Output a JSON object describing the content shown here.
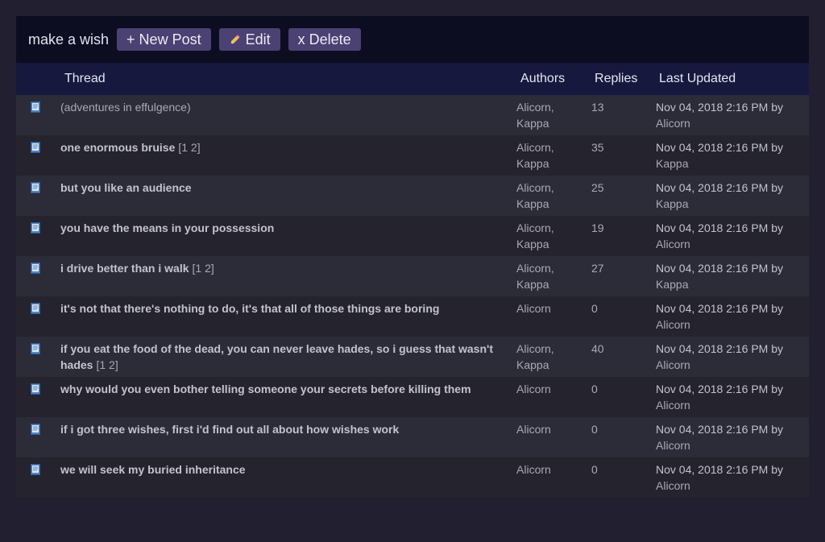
{
  "board": {
    "title": "make a wish",
    "buttons": {
      "new_post": "+ New Post",
      "edit": "Edit",
      "delete": "x Delete"
    }
  },
  "table": {
    "headers": {
      "thread": "Thread",
      "authors": "Authors",
      "replies": "Replies",
      "last_updated": "Last Updated"
    },
    "rows": [
      {
        "title": "(adventures in effulgence)",
        "bold": false,
        "pages": "",
        "authors_line1": "Alicorn,",
        "authors_line2": "Kappa",
        "replies": "13",
        "updated": "Nov 04, 2018 2:16 PM by",
        "updated_by": "Alicorn"
      },
      {
        "title": "one enormous bruise",
        "bold": true,
        "pages": "[1 2]",
        "authors_line1": "Alicorn,",
        "authors_line2": "Kappa",
        "replies": "35",
        "updated": "Nov 04, 2018 2:16 PM by",
        "updated_by": "Kappa"
      },
      {
        "title": "but you like an audience",
        "bold": true,
        "pages": "",
        "authors_line1": "Alicorn,",
        "authors_line2": "Kappa",
        "replies": "25",
        "updated": "Nov 04, 2018 2:16 PM by",
        "updated_by": "Kappa"
      },
      {
        "title": "you have the means in your possession",
        "bold": true,
        "pages": "",
        "authors_line1": "Alicorn,",
        "authors_line2": "Kappa",
        "replies": "19",
        "updated": "Nov 04, 2018 2:16 PM by",
        "updated_by": "Alicorn"
      },
      {
        "title": "i drive better than i walk",
        "bold": true,
        "pages": "[1 2]",
        "authors_line1": "Alicorn,",
        "authors_line2": "Kappa",
        "replies": "27",
        "updated": "Nov 04, 2018 2:16 PM by",
        "updated_by": "Kappa"
      },
      {
        "title": "it's not that there's nothing to do, it's that all of those things are boring",
        "bold": true,
        "pages": "",
        "authors_line1": "Alicorn",
        "authors_line2": "",
        "replies": "0",
        "updated": "Nov 04, 2018 2:16 PM by",
        "updated_by": "Alicorn"
      },
      {
        "title": "if you eat the food of the dead, you can never leave hades, so i guess that wasn't hades",
        "bold": true,
        "pages": "[1 2]",
        "authors_line1": "Alicorn,",
        "authors_line2": "Kappa",
        "replies": "40",
        "updated": "Nov 04, 2018 2:16 PM by",
        "updated_by": "Alicorn"
      },
      {
        "title": "why would you even bother telling someone your secrets before killing them",
        "bold": true,
        "pages": "",
        "authors_line1": "Alicorn",
        "authors_line2": "",
        "replies": "0",
        "updated": "Nov 04, 2018 2:16 PM by",
        "updated_by": "Alicorn"
      },
      {
        "title": "if i got three wishes, first i'd find out all about how wishes work",
        "bold": true,
        "pages": "",
        "authors_line1": "Alicorn",
        "authors_line2": "",
        "replies": "0",
        "updated": "Nov 04, 2018 2:16 PM by",
        "updated_by": "Alicorn"
      },
      {
        "title": "we will seek my buried inheritance",
        "bold": true,
        "pages": "",
        "authors_line1": "Alicorn",
        "authors_line2": "",
        "replies": "0",
        "updated": "Nov 04, 2018 2:16 PM by",
        "updated_by": "Alicorn"
      }
    ]
  },
  "icons": {
    "thread_icon": "document-icon",
    "edit_icon": "pencil-icon"
  }
}
